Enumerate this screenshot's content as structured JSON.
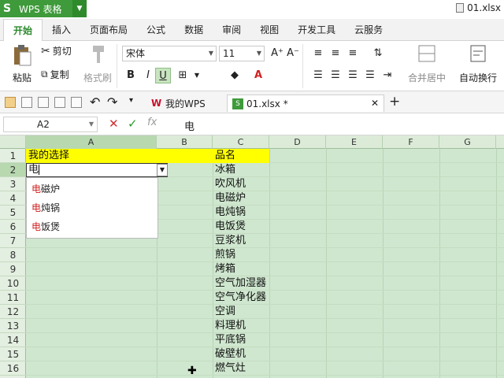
{
  "app": {
    "title": "WPS 表格",
    "logo": "S",
    "document": "01.xlsx"
  },
  "tabs": [
    "开始",
    "插入",
    "页面布局",
    "公式",
    "数据",
    "审阅",
    "视图",
    "开发工具",
    "云服务"
  ],
  "ribbon": {
    "cut": "剪切",
    "paste": "粘贴",
    "copy": "复制",
    "format_painter": "格式刷",
    "font": "宋体",
    "size": "11",
    "bold": "B",
    "italic": "I",
    "underline": "U",
    "merge_center": "合并居中",
    "wrap": "自动换行"
  },
  "quickbar": {
    "tab1": "我的WPS",
    "tab2": "01.xlsx *",
    "add": "+"
  },
  "formula": {
    "cellref": "A2",
    "content": "电"
  },
  "columns": [
    "A",
    "B",
    "C",
    "D",
    "E",
    "F",
    "G"
  ],
  "rows": [
    "1",
    "2",
    "3",
    "4",
    "5",
    "6",
    "7",
    "8",
    "9",
    "10",
    "11",
    "12",
    "13",
    "14",
    "15",
    "16"
  ],
  "cells": {
    "a1": "我的选择",
    "c_list": [
      "品名",
      "冰箱",
      "吹风机",
      "电磁炉",
      "电炖锅",
      "电饭煲",
      "豆浆机",
      "煎锅",
      "烤箱",
      "空气加湿器",
      "空气净化器",
      "空调",
      "料理机",
      "平底锅",
      "破壁机",
      "燃气灶"
    ]
  },
  "edit": {
    "value": "电"
  },
  "suggestions": [
    {
      "hl": "电",
      "rest": "磁炉"
    },
    {
      "hl": "电",
      "rest": "炖锅"
    },
    {
      "hl": "电",
      "rest": "饭煲"
    }
  ],
  "colors": {
    "accent": "#3e9a3a",
    "sheet": "#cfe7cf",
    "highlight": "#ffff00"
  }
}
